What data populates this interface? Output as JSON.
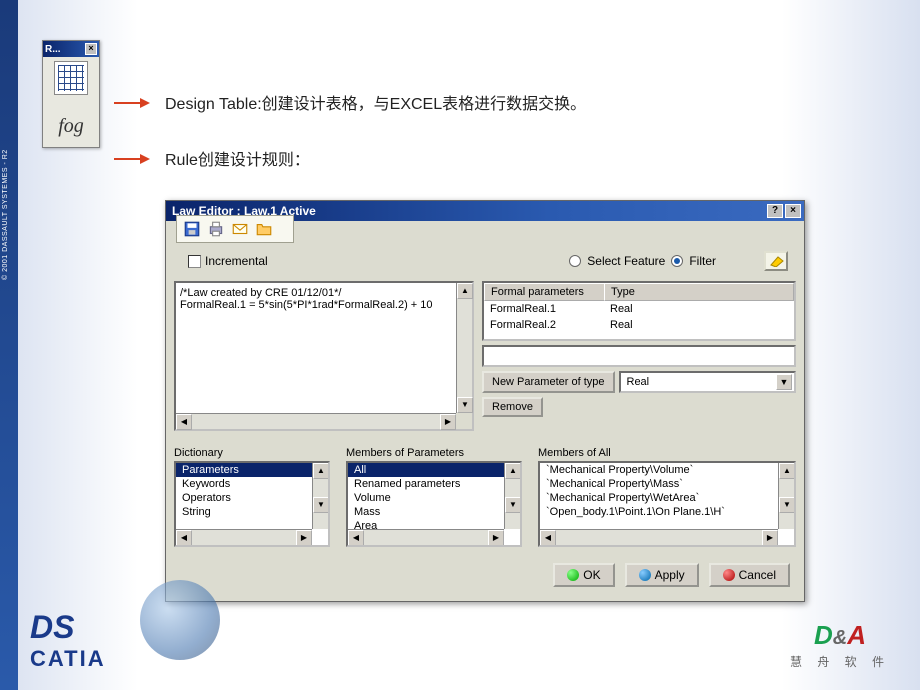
{
  "leftStripe": "© 2001 DASSAULT SYSTEMES - R2",
  "toolbarWindow": {
    "title": "R...",
    "fogLabel": "fog"
  },
  "labels": {
    "designTable": "Design Table:创建设计表格，与EXCEL表格进行数据交换。",
    "rule": "Rule创建设计规则："
  },
  "dialog": {
    "title": "Law Editor : Law.1 Active",
    "helpBtn": "?",
    "closeBtn": "×",
    "incremental": "Incremental",
    "selectFeature": "Select Feature",
    "filter": "Filter",
    "codeLines": [
      "/*Law created by CRE 01/12/01*/",
      "FormalReal.1 = 5*sin(5*PI*1rad*FormalReal.2) + 10"
    ],
    "paramTable": {
      "headers": {
        "params": "Formal parameters",
        "type": "Type"
      },
      "rows": [
        {
          "name": "FormalReal.1",
          "type": "Real"
        },
        {
          "name": "FormalReal.2",
          "type": "Real"
        }
      ]
    },
    "newParamBtn": "New Parameter of type",
    "typeSelect": "Real",
    "removeBtn": "Remove",
    "dictionary": {
      "label": "Dictionary",
      "items": [
        "Parameters",
        "Keywords",
        "Operators",
        "String"
      ]
    },
    "membersParams": {
      "label": "Members of Parameters",
      "items": [
        "All",
        "Renamed parameters",
        "Volume",
        "Mass",
        "Area"
      ]
    },
    "membersAll": {
      "label": "Members of All",
      "items": [
        "`Mechanical Property\\Volume`",
        "`Mechanical Property\\Mass`",
        "`Mechanical Property\\WetArea`",
        "`Open_body.1\\Point.1\\On Plane.1\\H`"
      ]
    },
    "okBtn": "OK",
    "applyBtn": "Apply",
    "cancelBtn": "Cancel"
  },
  "catiaLogo": {
    "ds": "DS",
    "name": "CATIA"
  },
  "drLogo": {
    "d": "D",
    "amp": "&",
    "a": "A",
    "sub": "慧 舟 软 件"
  }
}
